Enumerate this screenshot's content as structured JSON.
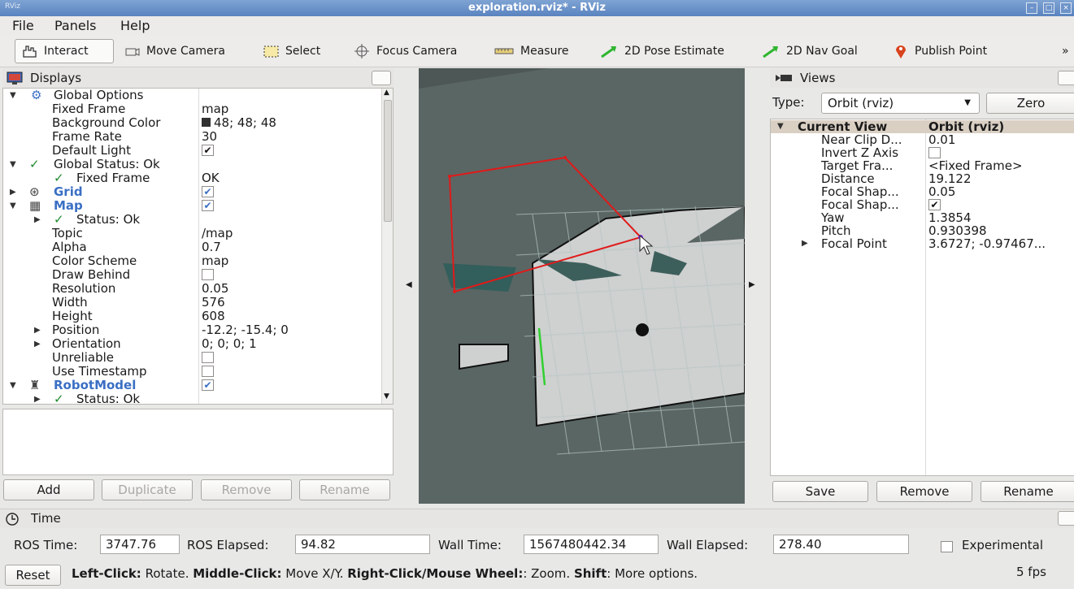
{
  "window": {
    "title": "exploration.rviz* - RViz",
    "app_icon": "RViz"
  },
  "menubar": {
    "file": "File",
    "panels": "Panels",
    "help": "Help"
  },
  "toolbar": {
    "interact": "Interact",
    "move_camera": "Move Camera",
    "select": "Select",
    "focus_camera": "Focus Camera",
    "measure": "Measure",
    "pose_estimate": "2D Pose Estimate",
    "nav_goal": "2D Nav Goal",
    "publish_point": "Publish Point",
    "more": "»"
  },
  "displays": {
    "title": "Displays",
    "rows": [
      {
        "label": "Global Options",
        "value": ""
      },
      {
        "label": "Fixed Frame",
        "value": "map"
      },
      {
        "label": "Background Color",
        "value": "48; 48; 48"
      },
      {
        "label": "Frame Rate",
        "value": "30"
      },
      {
        "label": "Default Light",
        "value": ""
      },
      {
        "label": "Global Status: Ok",
        "value": ""
      },
      {
        "label": "Fixed Frame",
        "value": "OK"
      },
      {
        "label": "Grid",
        "value": ""
      },
      {
        "label": "Map",
        "value": ""
      },
      {
        "label": "Status: Ok",
        "value": ""
      },
      {
        "label": "Topic",
        "value": "/map"
      },
      {
        "label": "Alpha",
        "value": "0.7"
      },
      {
        "label": "Color Scheme",
        "value": "map"
      },
      {
        "label": "Draw Behind",
        "value": ""
      },
      {
        "label": "Resolution",
        "value": "0.05"
      },
      {
        "label": "Width",
        "value": "576"
      },
      {
        "label": "Height",
        "value": "608"
      },
      {
        "label": "Position",
        "value": "-12.2; -15.4; 0"
      },
      {
        "label": "Orientation",
        "value": "0; 0; 0; 1"
      },
      {
        "label": "Unreliable",
        "value": ""
      },
      {
        "label": "Use Timestamp",
        "value": ""
      },
      {
        "label": "RobotModel",
        "value": ""
      },
      {
        "label": "Status: Ok",
        "value": ""
      }
    ],
    "buttons": {
      "add": "Add",
      "duplicate": "Duplicate",
      "remove": "Remove",
      "rename": "Rename"
    }
  },
  "views": {
    "title": "Views",
    "type_label": "Type:",
    "type_value": "Orbit (rviz)",
    "zero": "Zero",
    "header": {
      "label": "Current View",
      "value": "Orbit (rviz)"
    },
    "rows": [
      {
        "label": "Near Clip D...",
        "value": "0.01"
      },
      {
        "label": "Invert Z Axis",
        "value": ""
      },
      {
        "label": "Target Fra...",
        "value": "<Fixed Frame>"
      },
      {
        "label": "Distance",
        "value": "19.122"
      },
      {
        "label": "Focal Shap...",
        "value": "0.05"
      },
      {
        "label": "Focal Shap...",
        "value": ""
      },
      {
        "label": "Yaw",
        "value": "1.3854"
      },
      {
        "label": "Pitch",
        "value": "0.930398"
      },
      {
        "label": "Focal Point",
        "value": "3.6727; -0.97467..."
      }
    ],
    "buttons": {
      "save": "Save",
      "remove": "Remove",
      "rename": "Rename"
    }
  },
  "time": {
    "title": "Time",
    "ros_time_label": "ROS Time:",
    "ros_time": "3747.76",
    "ros_elapsed_label": "ROS Elapsed:",
    "ros_elapsed": "94.82",
    "wall_time_label": "Wall Time:",
    "wall_time": "1567480442.34",
    "wall_elapsed_label": "Wall Elapsed:",
    "wall_elapsed": "278.40",
    "experimental": "Experimental"
  },
  "status": {
    "reset": "Reset",
    "left_click": "Left-Click:",
    "left_click_desc": " Rotate. ",
    "middle_click": "Middle-Click:",
    "middle_click_desc": " Move X/Y. ",
    "right_click": "Right-Click/Mouse Wheel:",
    "right_click_desc": ": Zoom. ",
    "shift": "Shift",
    "shift_desc": ": More options.",
    "fps": "5 fps"
  },
  "colors": {
    "accent_blue": "#3a6fc4",
    "ok_green": "#1e8a2e",
    "viewport_bg": "#5a6664",
    "map_free": "#cfd0d0"
  }
}
